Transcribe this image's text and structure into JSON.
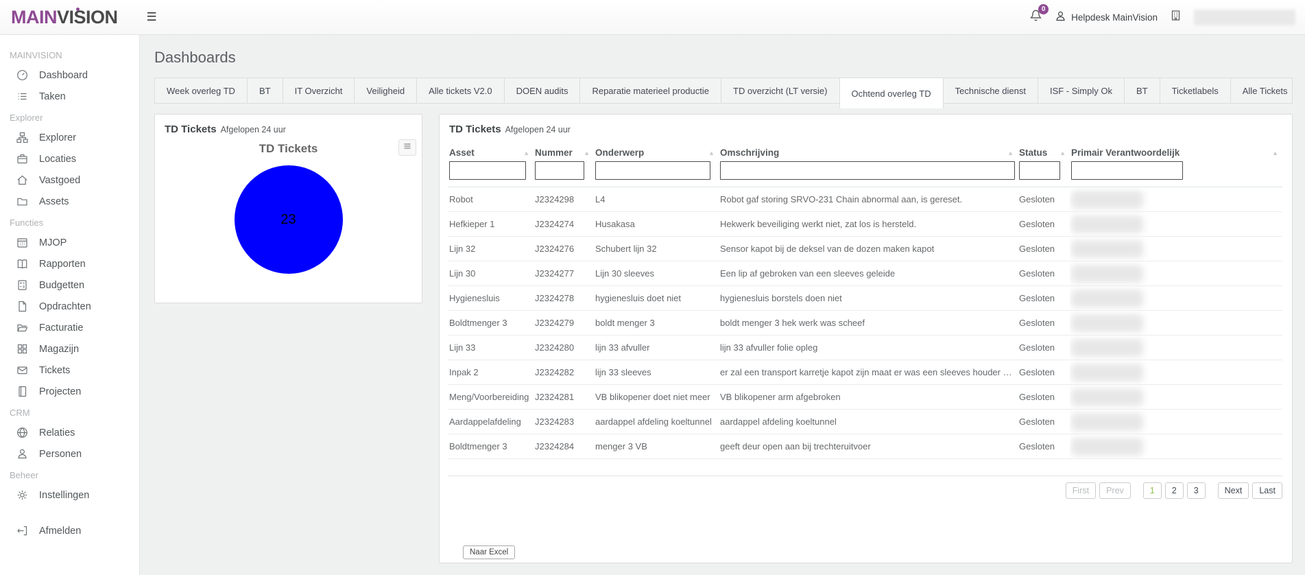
{
  "header": {
    "logo_main": "MAIN",
    "logo_vision": "VISION",
    "notification_badge": "0",
    "user_label": "Helpdesk MainVision"
  },
  "page": {
    "title": "Dashboards"
  },
  "sidebar": {
    "sections": [
      {
        "title": "MAINVISION",
        "items": [
          {
            "label": "Dashboard",
            "icon": "gauge"
          },
          {
            "label": "Taken",
            "icon": "task-list"
          }
        ]
      },
      {
        "title": "Explorer",
        "items": [
          {
            "label": "Explorer",
            "icon": "sitemap"
          },
          {
            "label": "Locaties",
            "icon": "briefcase"
          },
          {
            "label": "Vastgoed",
            "icon": "home"
          },
          {
            "label": "Assets",
            "icon": "folder"
          }
        ]
      },
      {
        "title": "Functies",
        "items": [
          {
            "label": "MJOP",
            "icon": "calendar"
          },
          {
            "label": "Rapporten",
            "icon": "book"
          },
          {
            "label": "Budgetten",
            "icon": "calculator"
          },
          {
            "label": "Opdrachten",
            "icon": "file"
          },
          {
            "label": "Facturatie",
            "icon": "folder-open"
          },
          {
            "label": "Magazijn",
            "icon": "grid"
          },
          {
            "label": "Tickets",
            "icon": "envelope"
          },
          {
            "label": "Projecten",
            "icon": "notebook"
          }
        ]
      },
      {
        "title": "CRM",
        "items": [
          {
            "label": "Relaties",
            "icon": "globe"
          },
          {
            "label": "Personen",
            "icon": "person"
          }
        ]
      },
      {
        "title": "Beheer",
        "items": [
          {
            "label": "Instellingen",
            "icon": "gear"
          }
        ]
      }
    ],
    "logout_label": "Afmelden"
  },
  "tabs": {
    "active_index": 8,
    "items": [
      {
        "label": "Week overleg TD"
      },
      {
        "label": "BT"
      },
      {
        "label": "IT Overzicht"
      },
      {
        "label": "Veiligheid"
      },
      {
        "label": "Alle tickets V2.0"
      },
      {
        "label": "DOEN audits"
      },
      {
        "label": "Reparatie materieel productie"
      },
      {
        "label": "TD overzicht (LT versie)"
      },
      {
        "label": "Ochtend overleg TD"
      },
      {
        "label": "Technische dienst"
      },
      {
        "label": "ISF - Simply Ok"
      },
      {
        "label": "BT"
      },
      {
        "label": "Ticketlabels"
      },
      {
        "label": "Alle Tickets"
      }
    ]
  },
  "pie_panel": {
    "title": "TD Tickets",
    "subtitle": "Afgelopen 24 uur",
    "chart_title": "TD Tickets",
    "value": "23",
    "pie_color": "#0000ff"
  },
  "chart_data": {
    "type": "pie",
    "title": "TD Tickets",
    "labels": [
      "TD Tickets"
    ],
    "values": [
      23
    ],
    "colors": [
      "#0000ff"
    ],
    "legend": false,
    "data_label": "23"
  },
  "table_panel": {
    "title": "TD Tickets",
    "subtitle": "Afgelopen 24 uur",
    "columns": [
      {
        "label": "Asset",
        "key": "asset"
      },
      {
        "label": "Nummer",
        "key": "nummer"
      },
      {
        "label": "Onderwerp",
        "key": "onderwerp"
      },
      {
        "label": "Omschrijving",
        "key": "omschrijving"
      },
      {
        "label": "Status",
        "key": "status"
      },
      {
        "label": "Primair Verantwoordelijk",
        "key": "primair"
      }
    ],
    "rows": [
      {
        "asset": "Robot",
        "nummer": "J2324298",
        "onderwerp": "L4",
        "omschrijving": "Robot gaf storing SRVO-231 Chain abnormal aan, is gereset.",
        "status": "Gesloten",
        "primair": "",
        "primair_redacted": true
      },
      {
        "asset": "Hefkieper 1",
        "nummer": "J2324274",
        "onderwerp": "Husakasa",
        "omschrijving": "Hekwerk beveiliging werkt niet, zat los is hersteld.",
        "status": "Gesloten",
        "primair": "",
        "primair_redacted": true
      },
      {
        "asset": "Lijn 32",
        "nummer": "J2324276",
        "onderwerp": "Schubert lijn 32",
        "omschrijving": "Sensor kapot bij de deksel van de dozen maken kapot",
        "status": "Gesloten",
        "primair": "",
        "primair_redacted": true
      },
      {
        "asset": "Lijn 30",
        "nummer": "J2324277",
        "onderwerp": "Lijn 30 sleeves",
        "omschrijving": "Een lip af gebroken van een sleeves geleide",
        "status": "Gesloten",
        "primair": "",
        "primair_redacted": true
      },
      {
        "asset": "Hygienesluis",
        "nummer": "J2324278",
        "onderwerp": "hygienesluis doet niet",
        "omschrijving": "hygienesluis borstels doen niet",
        "status": "Gesloten",
        "primair": "",
        "primair_redacted": true
      },
      {
        "asset": "Boldtmenger 3",
        "nummer": "J2324279",
        "onderwerp": "boldt menger 3",
        "omschrijving": "boldt menger 3 hek werk was scheef",
        "status": "Gesloten",
        "primair": "",
        "primair_redacted": true
      },
      {
        "asset": "Lijn 33",
        "nummer": "J2324280",
        "onderwerp": "lijn 33 afvuller",
        "omschrijving": "lijn 33 afvuller folie opleg",
        "status": "Gesloten",
        "primair": "",
        "primair_redacted": true
      },
      {
        "asset": "Inpak 2",
        "nummer": "J2324282",
        "onderwerp": "lijn 33 sleeves",
        "omschrijving": "er zal een transport karretje kapot zijn maat er was een sleeves houder weg k...",
        "status": "Gesloten",
        "primair": "",
        "primair_redacted": true
      },
      {
        "asset": "Meng/Voorbereiding",
        "nummer": "J2324281",
        "onderwerp": "VB blikopener doet niet meer",
        "omschrijving": "VB blikopener arm afgebroken",
        "status": "Gesloten",
        "primair": "",
        "primair_redacted": true
      },
      {
        "asset": "Aardappelafdeling",
        "nummer": "J2324283",
        "onderwerp": "aardappel afdeling koeltunnel",
        "omschrijving": "aardappel afdeling koeltunnel",
        "status": "Gesloten",
        "primair": "",
        "primair_redacted": true
      },
      {
        "asset": "Boldtmenger 3",
        "nummer": "J2324284",
        "onderwerp": "menger 3 VB",
        "omschrijving": "geeft deur open aan bij trechteruitvoer",
        "status": "Gesloten",
        "primair": "",
        "primair_redacted": true
      }
    ],
    "pagination": [
      {
        "label": "First",
        "state": "disabled"
      },
      {
        "label": "Prev",
        "state": "disabled"
      },
      {
        "label": "1",
        "state": "active"
      },
      {
        "label": "2",
        "state": "normal"
      },
      {
        "label": "3",
        "state": "normal"
      },
      {
        "label": "Next",
        "state": "normal"
      },
      {
        "label": "Last",
        "state": "normal"
      }
    ],
    "export_label": "Naar Excel"
  }
}
